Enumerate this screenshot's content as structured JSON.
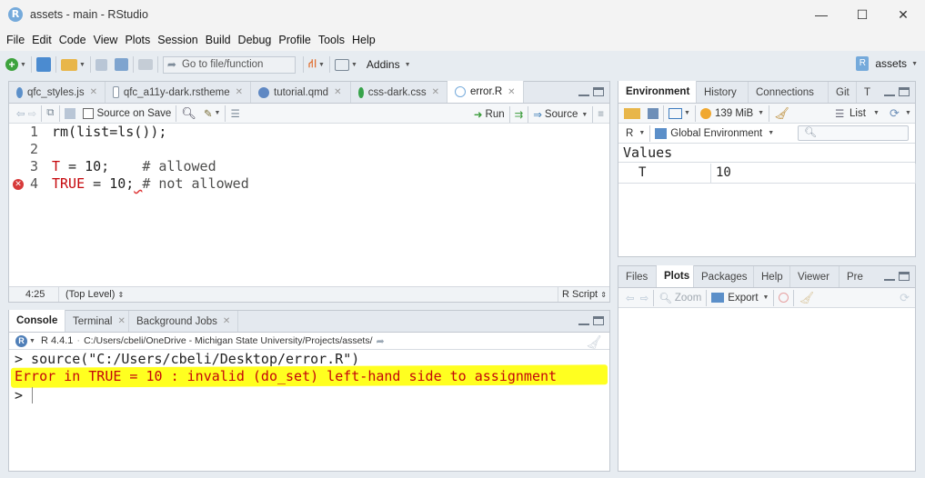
{
  "window": {
    "title": "assets - main - RStudio",
    "minimize": "—",
    "maximize": "☐",
    "close": "✕"
  },
  "menu": [
    "File",
    "Edit",
    "Code",
    "View",
    "Plots",
    "Session",
    "Build",
    "Debug",
    "Profile",
    "Tools",
    "Help"
  ],
  "toolbar": {
    "goto_placeholder": "Go to file/function",
    "addins": "Addins",
    "project": "assets"
  },
  "editor": {
    "tabs": [
      {
        "label": "qfc_styles.js"
      },
      {
        "label": "qfc_a11y-dark.rstheme"
      },
      {
        "label": "tutorial.qmd"
      },
      {
        "label": "css-dark.css"
      },
      {
        "label": "error.R"
      }
    ],
    "source_on_save": "Source on Save",
    "run": "Run",
    "source": "Source",
    "lines": [
      {
        "num": "1",
        "code": "rm(list=ls());"
      },
      {
        "num": "2",
        "code": ""
      },
      {
        "num": "3",
        "code": "T = 10;    # allowed"
      },
      {
        "num": "4",
        "code": "TRUE = 10; # not allowed"
      }
    ],
    "status_pos": "4:25",
    "status_scope": "(Top Level)",
    "status_type": "R Script"
  },
  "console": {
    "tabs": [
      "Console",
      "Terminal",
      "Background Jobs"
    ],
    "r_version": "R 4.4.1",
    "path": "C:/Users/cbeli/OneDrive - Michigan State University/Projects/assets/",
    "cmd": "> source(\"C:/Users/cbeli/Desktop/error.R\")",
    "error": "Error in TRUE = 10 : invalid (do_set) left-hand side to assignment",
    "prompt": ">"
  },
  "environment": {
    "tabs": [
      "Environment",
      "History",
      "Connections",
      "Git",
      "T"
    ],
    "memory": "139 MiB",
    "list": "List",
    "lang": "R",
    "scope": "Global Environment",
    "section": "Values",
    "vars": [
      {
        "name": "T",
        "value": "10"
      }
    ]
  },
  "files": {
    "tabs": [
      "Files",
      "Plots",
      "Packages",
      "Help",
      "Viewer",
      "Pre"
    ],
    "zoom": "Zoom",
    "export": "Export"
  },
  "colors": {
    "highlight": "#ffff20",
    "error": "#c5060b",
    "keyword": "#c5060b",
    "comment": "#4d4d4c"
  }
}
